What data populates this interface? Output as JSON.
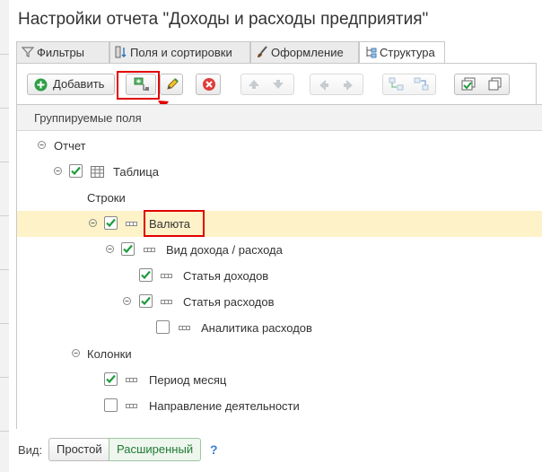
{
  "window": {
    "title": "Настройки отчета \"Доходы и расходы предприятия\""
  },
  "tabs": [
    {
      "label": "Фильтры",
      "icon": "funnel-icon"
    },
    {
      "label": "Поля и сортировки",
      "icon": "fields-sort-icon"
    },
    {
      "label": "Оформление",
      "icon": "brush-icon"
    },
    {
      "label": "Структура",
      "icon": "structure-icon",
      "active": true
    }
  ],
  "toolbar": {
    "add_label": "Добавить",
    "icons": [
      "add-group-icon",
      "pencil-icon",
      "delete-icon",
      "move-up-icon",
      "move-down-icon",
      "move-left-icon",
      "move-right-icon",
      "regroup-icon",
      "ungroup-icon",
      "check-all-icon",
      "copy-icon"
    ]
  },
  "tree": {
    "header": "Группируемые поля",
    "rows": [
      {
        "label": "Отчет"
      },
      {
        "label": "Таблица",
        "checked": true
      },
      {
        "label": "Строки"
      },
      {
        "label": "Валюта",
        "checked": true,
        "selected": true
      },
      {
        "label": "Вид дохода / расхода",
        "checked": true
      },
      {
        "label": "Статья доходов",
        "checked": true
      },
      {
        "label": "Статья расходов",
        "checked": true
      },
      {
        "label": "Аналитика расходов",
        "checked": false
      },
      {
        "label": "Колонки"
      },
      {
        "label": "Период месяц",
        "checked": true
      },
      {
        "label": "Направление деятельности",
        "checked": false
      }
    ]
  },
  "view": {
    "label": "Вид:",
    "simple": "Простой",
    "extended": "Расширенный",
    "active": "Расширенный",
    "help": "?"
  },
  "colors": {
    "accent": "#1f9c3f",
    "highlight": "#e10000",
    "selected_row": "#fdf2c8"
  }
}
